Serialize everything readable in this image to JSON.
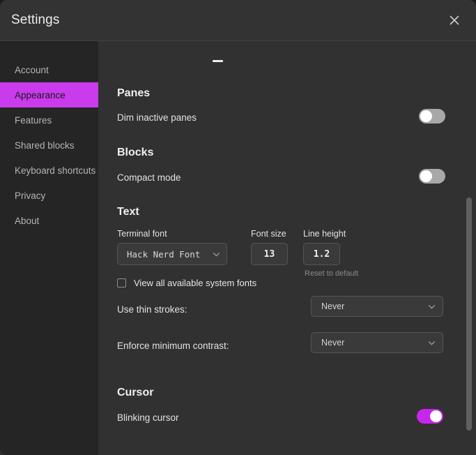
{
  "window": {
    "title": "Settings",
    "close_icon": "close-icon"
  },
  "accent_color": "#c93bec",
  "sidebar": {
    "items": [
      {
        "label": "Account",
        "active": false
      },
      {
        "label": "Appearance",
        "active": true
      },
      {
        "label": "Features",
        "active": false
      },
      {
        "label": "Shared blocks",
        "active": false
      },
      {
        "label": "Keyboard shortcuts",
        "active": false
      },
      {
        "label": "Privacy",
        "active": false
      },
      {
        "label": "About",
        "active": false
      }
    ]
  },
  "sections": {
    "panes": {
      "title": "Panes",
      "dim_inactive_panes_label": "Dim inactive panes",
      "dim_inactive_panes_state": "off"
    },
    "blocks": {
      "title": "Blocks",
      "compact_mode_label": "Compact mode",
      "compact_mode_state": "off"
    },
    "text": {
      "title": "Text",
      "terminal_font_label": "Terminal font",
      "terminal_font_value": "Hack Nerd Font",
      "font_size_label": "Font size",
      "font_size_value": "13",
      "line_height_label": "Line height",
      "line_height_value": "1.2",
      "reset_to_default_label": "Reset to default",
      "view_all_fonts_label": "View all available system fonts",
      "view_all_fonts_checked": false,
      "thin_strokes_label": "Use thin strokes:",
      "thin_strokes_value": "Never",
      "min_contrast_label": "Enforce minimum contrast:",
      "min_contrast_value": "Never"
    },
    "cursor": {
      "title": "Cursor",
      "blinking_cursor_label": "Blinking cursor",
      "blinking_cursor_state": "on"
    }
  }
}
